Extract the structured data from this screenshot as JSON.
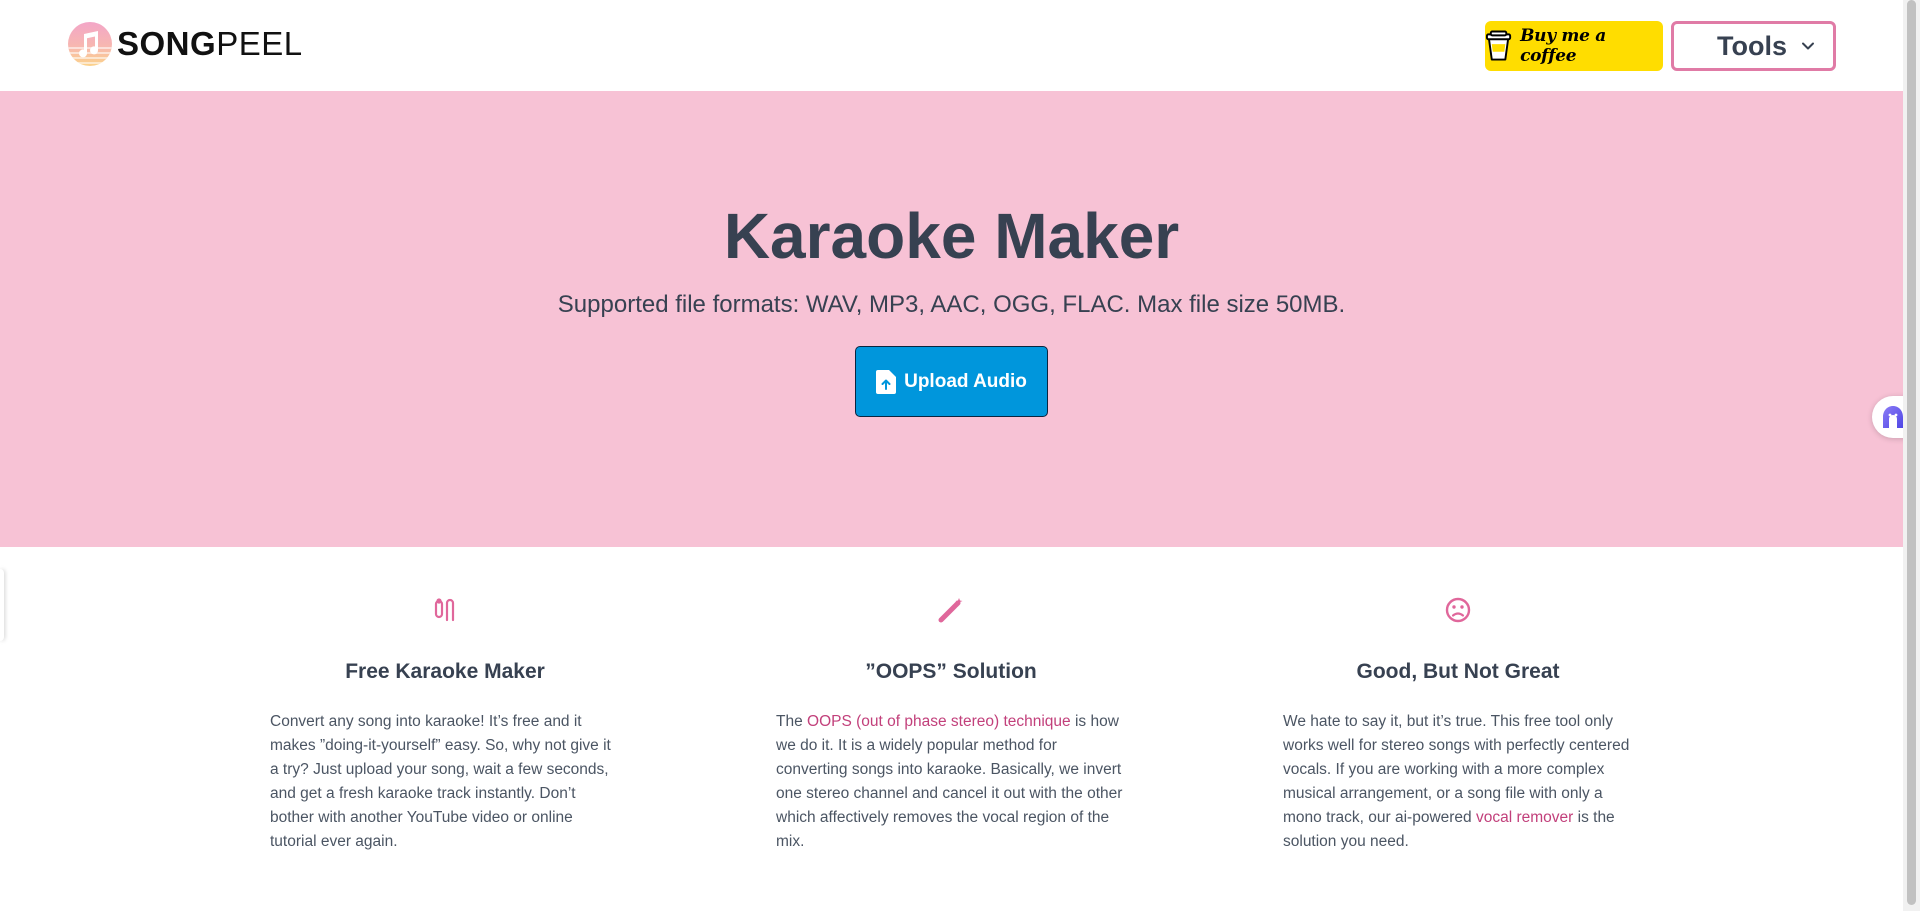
{
  "header": {
    "logo_bold": "SONG",
    "logo_light": "PEEL",
    "coffee_label": "Buy me a coffee",
    "tools_label": "Tools"
  },
  "hero": {
    "title": "Karaoke Maker",
    "subtitle": "Supported file formats: WAV, MP3, AAC, OGG, FLAC. Max file size 50MB.",
    "upload_label": "Upload Audio"
  },
  "features": [
    {
      "icon": "microphone-icon",
      "title": "Free Karaoke Maker",
      "text": "Convert any song into karaoke! It’s free and it makes ”doing-it-yourself” easy. So, why not give it a try? Just upload your song, wait a few seconds, and get a fresh karaoke track instantly. Don’t bother with another YouTube video or online tutorial ever again."
    },
    {
      "icon": "wand-icon",
      "title": "”OOPS” Solution",
      "text_before": "The ",
      "link": "OOPS (out of phase stereo) technique",
      "text_after": " is how we do it. It is a widely popular method for converting songs into karaoke. Basically, we invert one stereo channel and cancel it out with the other which affectively removes the vocal region of the mix."
    },
    {
      "icon": "sad-face-icon",
      "title": "Good, But Not Great",
      "text_before": "We hate to say it, but it’s true. This free tool only works well for stereo songs with perfectly centered vocals. If you are working with a more complex musical arrangement, or a song file with only a mono track, our ai-powered ",
      "link": "vocal remover",
      "text_after": " is the solution you need."
    }
  ],
  "colors": {
    "hero_bg": "#f7c2d5",
    "accent_pink": "#c2407b",
    "upload_blue": "#0096dc",
    "coffee_yellow": "#ffdd00",
    "tools_border": "#e07ba6"
  }
}
